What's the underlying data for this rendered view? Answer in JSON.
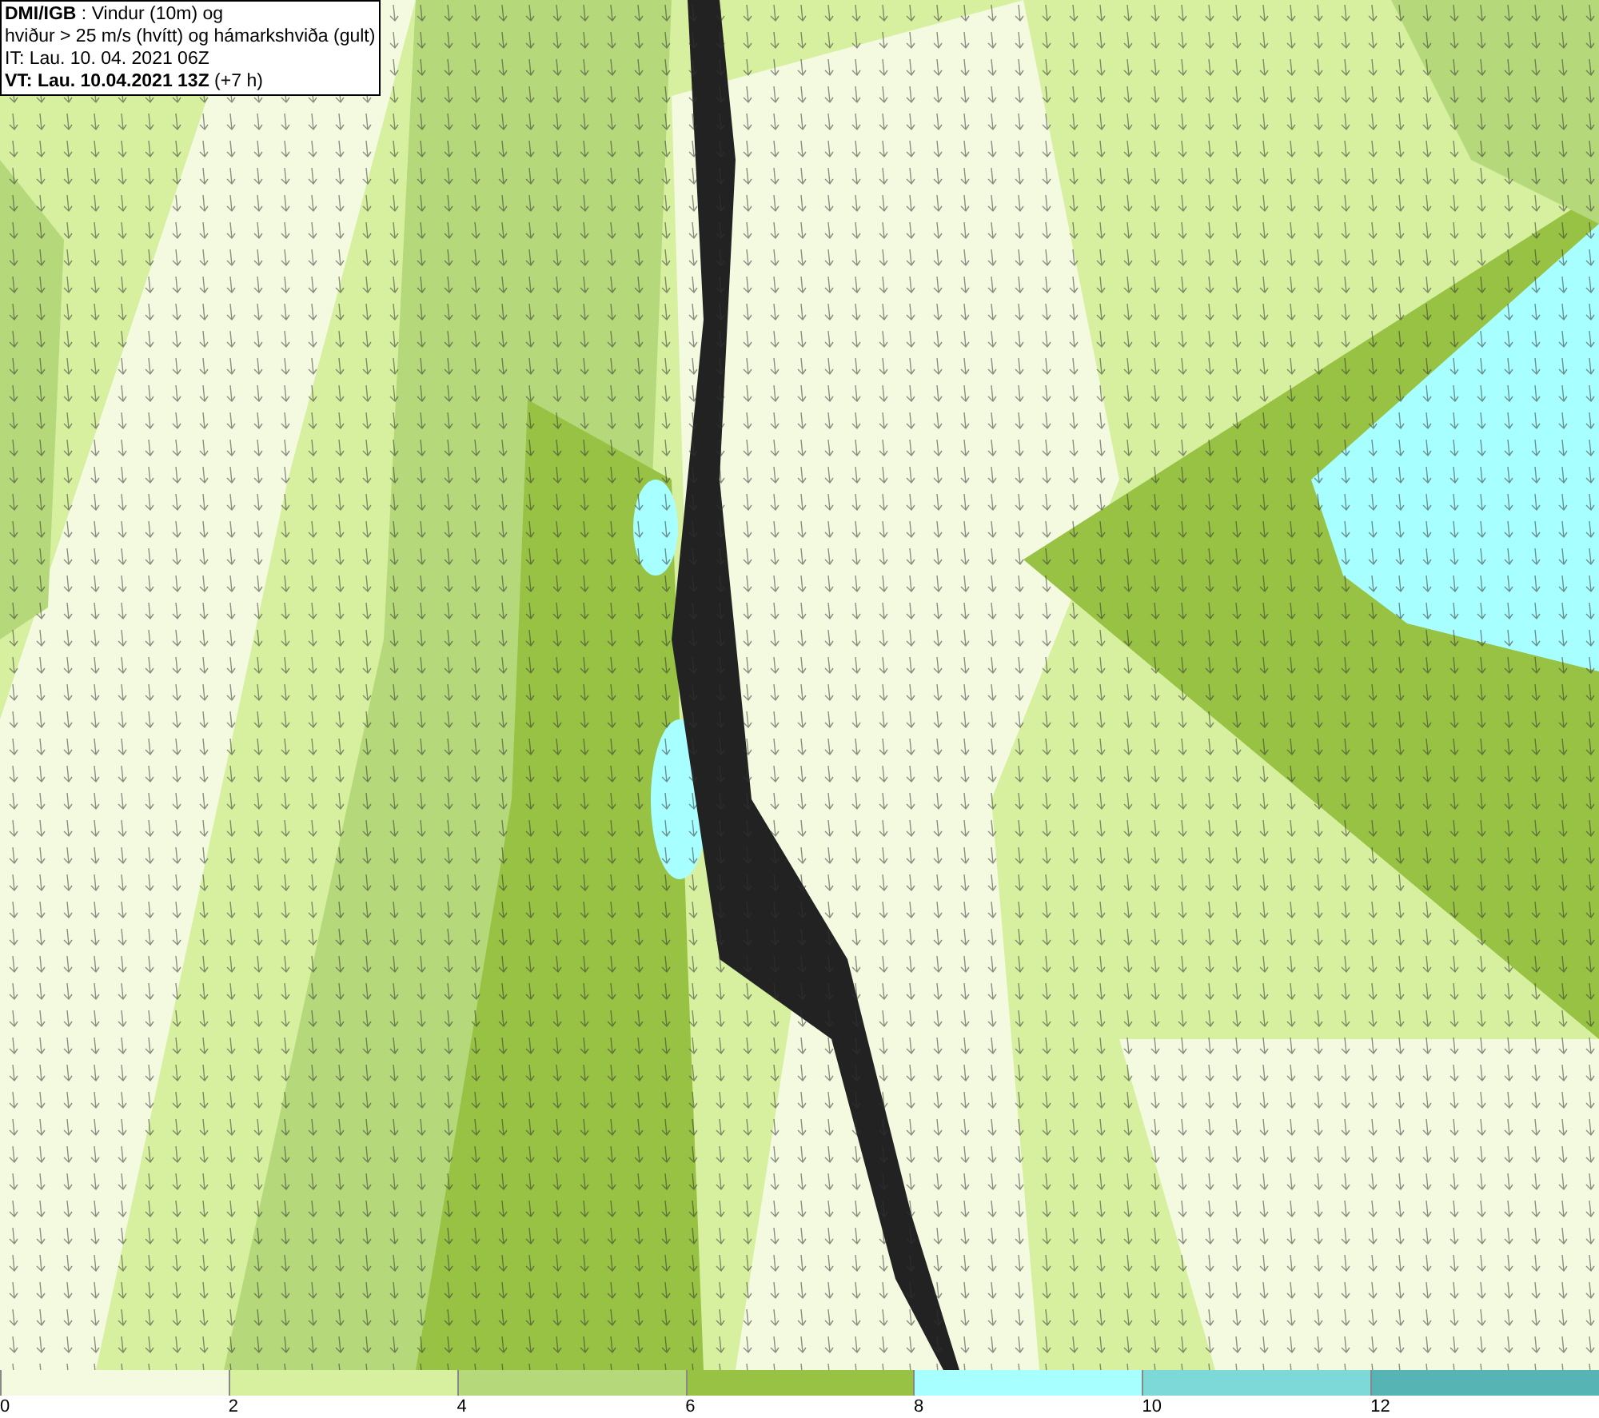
{
  "info_box": {
    "lines": [
      "**DMI/IGB** : Vindur (10m) og",
      "hviður > 25 m/s (hvítt) og hámarkshviða (gult)",
      "IT: Lau. 10. 04. 2021 06Z",
      "**VT: Lau. 10.04.2021 13Z** (+7 h)"
    ]
  },
  "legend": {
    "bins": [
      {
        "color": "#f3fadf",
        "label": "0"
      },
      {
        "color": "#d7f0a0",
        "label": "2"
      },
      {
        "color": "#b5d97a",
        "label": "4"
      },
      {
        "color": "#98c244",
        "label": "6"
      },
      {
        "color": "#a8ffff",
        "label": "8"
      },
      {
        "color": "#7dd8d8",
        "label": "10"
      },
      {
        "color": "#56b4b4",
        "label": "12"
      }
    ]
  }
}
